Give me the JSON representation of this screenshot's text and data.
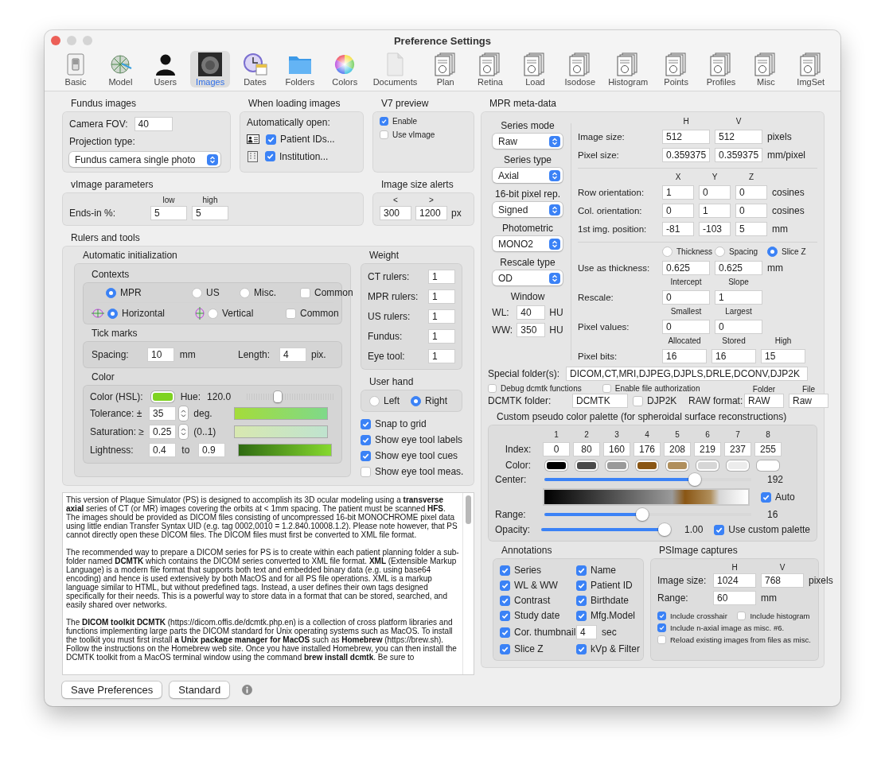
{
  "window": {
    "title": "Preference Settings"
  },
  "toolbar": [
    {
      "label": "Basic",
      "kind": "switch",
      "selected": false
    },
    {
      "label": "Model",
      "kind": "globe",
      "selected": false
    },
    {
      "label": "Users",
      "kind": "person",
      "selected": false
    },
    {
      "label": "Images",
      "kind": "photo",
      "selected": true
    },
    {
      "label": "Dates",
      "kind": "clock",
      "selected": false
    },
    {
      "label": "Folders",
      "kind": "folder",
      "selected": false
    },
    {
      "label": "Colors",
      "kind": "wheel",
      "selected": false
    },
    {
      "label": "Documents",
      "kind": "document",
      "selected": false
    },
    {
      "label": "Plan",
      "kind": "sheets",
      "selected": false
    },
    {
      "label": "Retina",
      "kind": "sheets",
      "selected": false
    },
    {
      "label": "Load",
      "kind": "sheets",
      "selected": false
    },
    {
      "label": "Isodose",
      "kind": "sheets",
      "selected": false
    },
    {
      "label": "Histogram",
      "kind": "sheets",
      "selected": false
    },
    {
      "label": "Points",
      "kind": "sheets",
      "selected": false
    },
    {
      "label": "Profiles",
      "kind": "sheets",
      "selected": false
    },
    {
      "label": "Misc",
      "kind": "sheets",
      "selected": false
    },
    {
      "label": "ImgSet",
      "kind": "sheets",
      "selected": false
    }
  ],
  "fundus": {
    "title": "Fundus images",
    "fov_label": "Camera FOV:",
    "fov": "40",
    "projection_label": "Projection type:",
    "projection": "Fundus camera single photo"
  },
  "loading": {
    "title": "When loading images",
    "prompt": "Automatically open:",
    "options": [
      {
        "kind": "id-card",
        "label": "Patient IDs...",
        "checked": true
      },
      {
        "kind": "building",
        "label": "Institution...",
        "checked": true
      }
    ]
  },
  "v7_preview": {
    "title": "V7 preview",
    "options": [
      {
        "label": "Enable",
        "checked": true
      },
      {
        "label": "Use vImage",
        "checked": false
      }
    ]
  },
  "vimage": {
    "title": "vImage parameters",
    "label": "Ends-in %:",
    "low_label": "low",
    "high_label": "high",
    "low": "5",
    "high": "5"
  },
  "size_alerts": {
    "title": "Image size alerts",
    "min_label": "<",
    "max_label": ">",
    "min": "300",
    "max": "1200",
    "unit": "px"
  },
  "rulers": {
    "title": "Rulers and tools",
    "auto_title": "Automatic initialization",
    "contexts": {
      "title": "Contexts",
      "modes": [
        {
          "label": "MPR",
          "selected": true
        },
        {
          "label": "US",
          "selected": false
        },
        {
          "label": "Misc.",
          "selected": false
        }
      ],
      "modes_common": {
        "label": "Common",
        "checked": false
      },
      "orientations": [
        {
          "kind": "horizontal",
          "label": "Horizontal",
          "selected": true
        },
        {
          "kind": "vertical",
          "label": "Vertical",
          "selected": false
        }
      ],
      "orientations_common": {
        "label": "Common",
        "checked": false
      }
    },
    "ticks": {
      "title": "Tick marks",
      "spacing_label": "Spacing:",
      "spacing": "10",
      "spacing_unit": "mm",
      "length_label": "Length:",
      "length": "4",
      "length_unit": "pix."
    },
    "color": {
      "title": "Color",
      "color_label": "Color (HSL):",
      "hue_label": "Hue:",
      "hue": "120.0",
      "hue_slider": {
        "level": 0.34
      },
      "tolerance_label": "Tolerance: ±",
      "tolerance": "35",
      "tolerance_unit": "deg.",
      "saturation_label": "Saturation: ≥",
      "saturation": "0.25",
      "saturation_unit": "(0..1)",
      "lightness_label": "Lightness:",
      "lightness_from": "0.4",
      "lightness_to_label": "to",
      "lightness_to": "0.9"
    },
    "weight": {
      "title": "Weight",
      "rows": [
        {
          "label": "CT rulers:",
          "value": "1"
        },
        {
          "label": "MPR rulers:",
          "value": "1"
        },
        {
          "label": "US rulers:",
          "value": "1"
        },
        {
          "label": "Fundus:",
          "value": "1"
        },
        {
          "label": "Eye tool:",
          "value": "1"
        }
      ]
    },
    "user_hand": {
      "title": "User hand",
      "options": [
        {
          "label": "Left",
          "selected": false
        },
        {
          "label": "Right",
          "selected": true
        }
      ]
    },
    "options": [
      {
        "label": "Snap to grid",
        "checked": true
      },
      {
        "label": "Show eye tool labels",
        "checked": true
      },
      {
        "label": "Show eye tool cues",
        "checked": true
      },
      {
        "label": "Show eye tool meas.",
        "checked": false
      }
    ]
  },
  "notes": {
    "paragraphs": [
      "This version of Plaque Simulator (PS) is designed to accomplish its 3D ocular modeling using a **transverse axial** series of CT (or MR) images covering the orbits at  < 1mm spacing. The patient must be scanned **HFS**. The images should be provided as DICOM files consisting of uncompressed 16-bit MONOCHROME pixel data using little endian Transfer Syntax UID (e.g. tag 0002,0010 = 1.2.840.10008.1.2). Please note however, that PS cannot directly open these DICOM files. The DICOM files must first be converted to XML file format.",
      "The recommended way to prepare a DICOM series for PS is to create within each patient planning folder a sub-folder named **DCMTK** which contains the DICOM series converted to XML file format. **XML** (Extensible Markup Language) is a modern file format that supports both text and embedded binary data (e.g. using base64 encoding) and hence is used extensively by both MacOS and for all PS file operations. XML is a markup language similar to HTML, but without predefined tags. Instead, a user defines their own tags designed specifically for their needs. This is a powerful way to store data in a format that can be stored, searched, and easily shared over networks.",
      "The **DICOM toolkit DCMTK** (https://dicom.offis.de/dcmtk.php.en) is a collection of cross platform libraries and functions implementing large parts the DICOM standard for Unix operating systems such as MacOS. To install the toolkit you must first install **a Unix package manager for MacOS** such as **Homebrew** (https://brew.sh). Follow the instructions on the Homebrew web site. Once you have installed Homebrew, you can then install the DCMTK toolkit from a MacOS terminal window using the command **brew install dcmtk**. Be sure to"
    ]
  },
  "buttons": [
    {
      "label": "Save Preferences"
    },
    {
      "label": "Standard"
    }
  ],
  "mpr": {
    "title": "MPR meta-data",
    "selectors": [
      {
        "label": "Series mode",
        "value": "Raw"
      },
      {
        "label": "Series type",
        "value": "Axial"
      },
      {
        "label": "16-bit pixel rep.",
        "value": "Signed"
      },
      {
        "label": "Photometric",
        "value": "MONO2"
      },
      {
        "label": "Rescale type",
        "value": "OD"
      }
    ],
    "window": {
      "title": "Window",
      "rows": [
        {
          "label": "WL:",
          "value": "40",
          "unit": "HU"
        },
        {
          "label": "WW:",
          "value": "350",
          "unit": "HU"
        }
      ]
    },
    "blocks": [
      {
        "kind": "pair",
        "headers": [
          "H",
          "V"
        ],
        "rows": [
          {
            "label": "Image size:",
            "values": [
              "512",
              "512"
            ],
            "unit": "pixels"
          },
          {
            "label": "Pixel size:",
            "values": [
              "0.359375",
              "0.359375"
            ],
            "unit": "mm/pixel"
          }
        ]
      },
      {
        "kind": "triple",
        "headers": [
          "X",
          "Y",
          "Z"
        ],
        "rows": [
          {
            "label": "Row orientation:",
            "values": [
              "1",
              "0",
              "0"
            ],
            "unit": "cosines"
          },
          {
            "label": "Col. orientation:",
            "values": [
              "0",
              "1",
              "0"
            ],
            "unit": "cosines"
          },
          {
            "label": "1st img. position:",
            "values": [
              "-81",
              "-103",
              "5"
            ],
            "unit": "mm"
          }
        ]
      },
      {
        "kind": "pair",
        "radios": [
          {
            "label": "Thickness",
            "selected": false
          },
          {
            "label": "Spacing",
            "selected": false
          },
          {
            "label": "Slice Z",
            "selected": true
          }
        ],
        "rows": [
          {
            "label": "Use as thickness:",
            "values": [
              "0.625",
              "0.625"
            ],
            "unit": "mm"
          }
        ]
      },
      {
        "kind": "pair",
        "headers": [
          "Intercept",
          "Slope"
        ],
        "rows": [
          {
            "label": "Rescale:",
            "values": [
              "0",
              "1"
            ]
          }
        ]
      },
      {
        "kind": "pair",
        "headers": [
          "Smallest",
          "Largest"
        ],
        "rows": [
          {
            "label": "Pixel values:",
            "values": [
              "0",
              "0"
            ]
          }
        ]
      },
      {
        "kind": "bits",
        "headers": [
          "Allocated",
          "Stored",
          "High"
        ],
        "rows": [
          {
            "label": "Pixel bits:",
            "values": [
              "16",
              "16",
              "15"
            ]
          }
        ]
      }
    ],
    "special_folders": {
      "label": "Special folder(s):",
      "value": "DICOM,CT,MRI,DJPEG,DJPLS,DRLE,DCONV,DJP2K"
    },
    "flags": [
      {
        "label": "Debug dcmtk functions",
        "checked": false
      },
      {
        "label": "Enable file authorization",
        "checked": false
      }
    ],
    "dcmtk": {
      "label": "DCMTK folder:",
      "value": "DCMTK",
      "djp2k": {
        "label": "DJP2K",
        "checked": false
      },
      "raw_label": "RAW format:",
      "folder_label": "Folder",
      "file_label": "File",
      "folder": "RAW",
      "file": "Raw"
    }
  },
  "palette": {
    "title": "Custom pseudo color palette (for spheroidal surface reconstructions)",
    "index_label": "Index:",
    "color_label": "Color:",
    "entries": [
      {
        "number": "1",
        "index": "0",
        "color": "#000000"
      },
      {
        "number": "2",
        "index": "80",
        "color": "#4a4a4a"
      },
      {
        "number": "3",
        "index": "160",
        "color": "#9a9a9a"
      },
      {
        "number": "4",
        "index": "176",
        "color": "#8a5614"
      },
      {
        "number": "5",
        "index": "208",
        "color": "#b08f5c"
      },
      {
        "number": "6",
        "index": "219",
        "color": "#d6d6d6"
      },
      {
        "number": "7",
        "index": "237",
        "color": "#ececec"
      },
      {
        "number": "8",
        "index": "255",
        "color": "#ffffff"
      }
    ],
    "center": {
      "label": "Center:",
      "level": 0.74,
      "reading": "192"
    },
    "auto": {
      "label": "Auto",
      "checked": true
    },
    "range": {
      "label": "Range:",
      "level": 0.47,
      "reading": "16"
    },
    "opacity": {
      "label": "Opacity:",
      "level": 1,
      "reading": "1.00"
    },
    "custom": {
      "label": "Use custom palette",
      "checked": true
    }
  },
  "annotations": {
    "title": "Annotations",
    "items": [
      {
        "kind": "check",
        "label": "Series",
        "checked": true
      },
      {
        "kind": "check",
        "label": "Name",
        "checked": true
      },
      {
        "kind": "check",
        "label": "WL & WW",
        "checked": true
      },
      {
        "kind": "check",
        "label": "Patient ID",
        "checked": true
      },
      {
        "kind": "check",
        "label": "Contrast",
        "checked": true
      },
      {
        "kind": "check",
        "label": "Birthdate",
        "checked": true
      },
      {
        "kind": "check",
        "label": "Study date",
        "checked": true
      },
      {
        "kind": "check",
        "label": "Mfg.Model",
        "checked": true
      },
      {
        "kind": "check",
        "label": "Cor. thumbnail",
        "checked": true
      },
      {
        "kind": "seconds",
        "value": "4",
        "unit": "sec"
      },
      {
        "kind": "check",
        "label": "Slice Z",
        "checked": true
      },
      {
        "kind": "check",
        "label": "kVp & Filter",
        "checked": true
      }
    ]
  },
  "captures": {
    "title": "PSImage captures",
    "headers": [
      "H",
      "V"
    ],
    "size_label": "Image size:",
    "size": [
      "1024",
      "768"
    ],
    "size_unit": "pixels",
    "range_label": "Range:",
    "range": "60",
    "range_unit": "mm",
    "options": [
      {
        "label": "Include crosshair",
        "checked": true
      },
      {
        "label": "Include histogram",
        "checked": false
      },
      {
        "label": "Include n-axial image as misc. #6.",
        "checked": true
      },
      {
        "label": "Reload existing images from files as misc.",
        "checked": false
      }
    ]
  }
}
